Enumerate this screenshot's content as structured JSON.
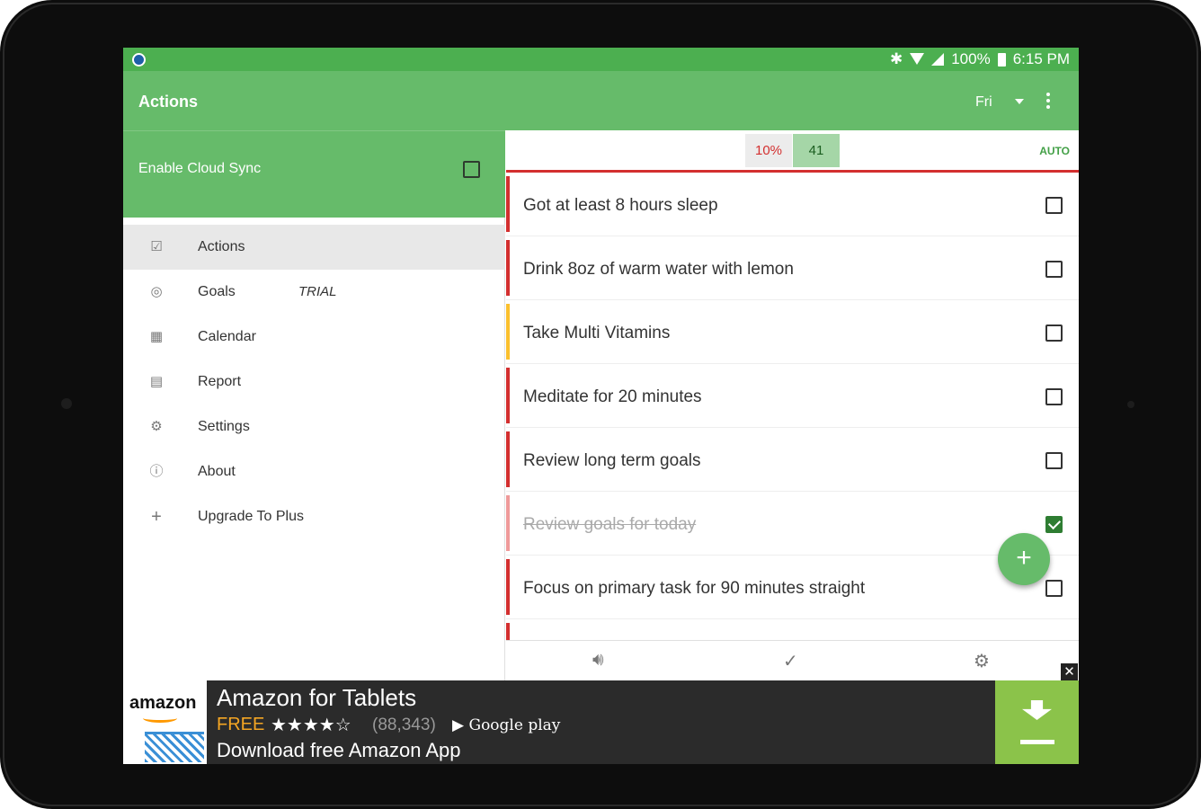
{
  "status_bar": {
    "battery": "100%",
    "time": "6:15 PM"
  },
  "app_bar": {
    "title": "Actions",
    "day": "Fri"
  },
  "drawer": {
    "cloud_sync_label": "Enable Cloud Sync",
    "cloud_sync_checked": false,
    "items": [
      {
        "label": "Actions",
        "icon": "checkbox-icon",
        "active": true
      },
      {
        "label": "Goals",
        "icon": "target-icon",
        "badge": "TRIAL"
      },
      {
        "label": "Calendar",
        "icon": "calendar-icon"
      },
      {
        "label": "Report",
        "icon": "report-icon"
      },
      {
        "label": "Settings",
        "icon": "gear-icon"
      },
      {
        "label": "About",
        "icon": "info-icon"
      },
      {
        "label": "Upgrade To Plus",
        "icon": "plus-icon"
      }
    ]
  },
  "summary": {
    "percent": "10%",
    "score": "41",
    "mode": "AUTO"
  },
  "actions": [
    {
      "text": "Got at least 8 hours sleep",
      "done": false,
      "color": "#d32f2f"
    },
    {
      "text": "Drink 8oz of warm water with lemon",
      "done": false,
      "color": "#d32f2f"
    },
    {
      "text": "Take Multi Vitamins",
      "done": false,
      "color": "#fbc02d"
    },
    {
      "text": "Meditate for 20 minutes",
      "done": false,
      "color": "#d32f2f"
    },
    {
      "text": "Review long term goals",
      "done": false,
      "color": "#d32f2f"
    },
    {
      "text": "Review goals for today",
      "done": true,
      "color": "#ef9a9a"
    },
    {
      "text": "Focus on primary task for 90 minutes straight",
      "done": false,
      "color": "#d32f2f"
    }
  ],
  "ad": {
    "brand": "amazon",
    "headline": "Amazon for Tablets",
    "price": "FREE",
    "stars": "★★★★☆",
    "rating_count": "(88,343)",
    "store": "Google play",
    "subtext": "Download free Amazon App",
    "close": "✕"
  },
  "colors": {
    "primary": "#66bb6a",
    "status": "#4caf50",
    "accent_red": "#d32f2f"
  }
}
